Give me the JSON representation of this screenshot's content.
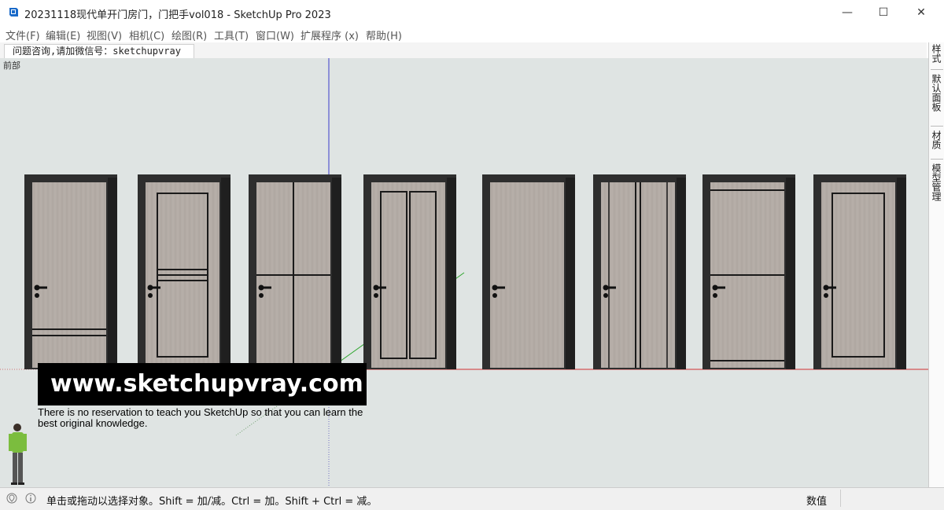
{
  "window": {
    "title": "20231118现代单开门房门，门把手vol018 - SketchUp Pro 2023",
    "minimize_glyph": "—",
    "maximize_glyph": "☐",
    "close_glyph": "✕"
  },
  "menu": [
    {
      "label": "文件(F)"
    },
    {
      "label": "编辑(E)"
    },
    {
      "label": "视图(V)"
    },
    {
      "label": "相机(C)"
    },
    {
      "label": "绘图(R)"
    },
    {
      "label": "工具(T)"
    },
    {
      "label": "窗口(W)"
    },
    {
      "label": "扩展程序 (x)"
    },
    {
      "label": "帮助(H)"
    }
  ],
  "scene_tab": {
    "label": "问题咨询,请加微信号：sketchupvray"
  },
  "viewport": {
    "view_label": "前部"
  },
  "tray_tabs": [
    {
      "label": "样式"
    },
    {
      "label": "默认面板"
    },
    {
      "label": "材质"
    },
    {
      "label": "模型管理"
    }
  ],
  "doors": [
    {
      "style": "twin-bottom-lines"
    },
    {
      "style": "frame-with-mid-lines"
    },
    {
      "style": "cross-split"
    },
    {
      "style": "twin-vertical-panels"
    },
    {
      "style": "plain"
    },
    {
      "style": "narrow-center-strip"
    },
    {
      "style": "top-and-mid-lines"
    },
    {
      "style": "single-frame"
    }
  ],
  "watermark": {
    "url": "www.sketchupvray.com",
    "tagline": "There is no reservation to teach you SketchUp so that you can learn the best original knowledge."
  },
  "status": {
    "message": "单击或拖动以选择对象。Shift = 加/减。Ctrl = 加。Shift + Ctrl = 减。",
    "measure_label": "数值",
    "measure_value": ""
  },
  "colors": {
    "viewport_bg": "#dfe4e3",
    "door_wood": "#b3aca6",
    "door_frame": "#2e2e2e",
    "axis_red": "#d03030",
    "axis_green": "#2da52d",
    "axis_blue": "#3a3acb"
  }
}
